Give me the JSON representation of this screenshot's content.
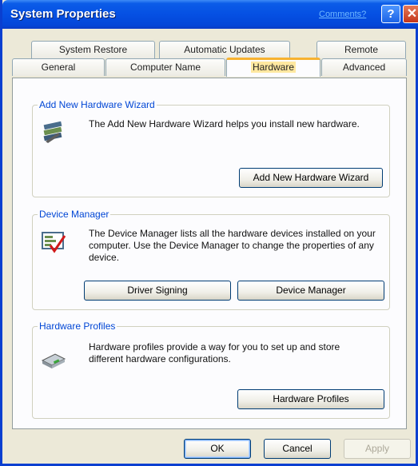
{
  "window": {
    "title": "System Properties",
    "comments_link": "Comments?",
    "help_glyph": "?",
    "close_glyph": "✕"
  },
  "tabs_row_back": [
    {
      "label": "System Restore"
    },
    {
      "label": "Automatic Updates"
    },
    {
      "label": "Remote"
    }
  ],
  "tabs_row_front": [
    {
      "label": "General"
    },
    {
      "label": "Computer Name"
    },
    {
      "label": "Hardware",
      "selected": true
    },
    {
      "label": "Advanced"
    }
  ],
  "groups": {
    "wizard": {
      "title": "Add New Hardware Wizard",
      "description": "The Add New Hardware Wizard helps you install new hardware.",
      "button": "Add New Hardware Wizard",
      "icon": "hardware-wizard-icon"
    },
    "device_manager": {
      "title": "Device Manager",
      "description": "The Device Manager lists all the hardware devices installed on your computer. Use the Device Manager to change the properties of any device.",
      "buttons": [
        "Driver Signing",
        "Device Manager"
      ],
      "icon": "device-manager-icon"
    },
    "profiles": {
      "title": "Hardware Profiles",
      "description": "Hardware profiles provide a way for you to set up and store different hardware configurations.",
      "button": "Hardware Profiles",
      "icon": "hardware-profiles-icon"
    }
  },
  "footer": {
    "ok": "OK",
    "cancel": "Cancel",
    "apply": "Apply"
  },
  "colors": {
    "title_bar": "#0550e3",
    "group_title": "#0046d5",
    "selected_tab_accent": "#f7b230"
  }
}
